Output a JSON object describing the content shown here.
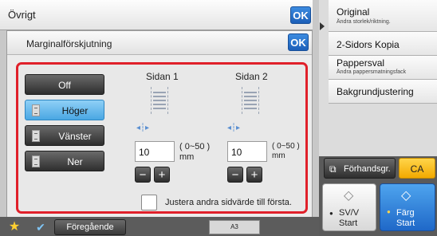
{
  "top_panel": {
    "title": "Övrigt",
    "ok_label": "OK"
  },
  "dialog": {
    "title": "Marginalförskjutning",
    "ok_label": "OK",
    "directions": [
      {
        "label": "Off",
        "selected": false
      },
      {
        "label": "Höger",
        "selected": true
      },
      {
        "label": "Vänster",
        "selected": false
      },
      {
        "label": "Ner",
        "selected": false
      }
    ],
    "side1": {
      "heading": "Sidan 1",
      "value": "10",
      "range": "( 0~50 )",
      "unit": "mm"
    },
    "side2": {
      "heading": "Sidan 2",
      "value": "10",
      "range": "( 0~50 )",
      "unit": "mm"
    },
    "stepper": {
      "minus": "−",
      "plus": "+"
    },
    "checkbox_label": "Justera andra sidvärde till första."
  },
  "right_menu": {
    "items": [
      {
        "title": "Original",
        "subtitle": "Ändra storlek/riktning."
      },
      {
        "title": "2-Sidors Kopia",
        "subtitle": ""
      },
      {
        "title": "Pappersval",
        "subtitle": "Ändra pappersmatningsfack"
      },
      {
        "title": "Bakgrundjustering",
        "subtitle": ""
      }
    ],
    "preview_label": "Förhandsgr.",
    "ca_label": "CA",
    "start_bw": {
      "line1": "SV/V",
      "line2": "Start"
    },
    "start_color": {
      "line1": "Färg",
      "line2": "Start"
    }
  },
  "bottom_bar": {
    "previous_label": "Föregående",
    "tray_label": "A3"
  },
  "colors": {
    "ok_blue": "#1c5fb8",
    "highlight_red": "#e0202a",
    "selected_blue": "#4aa7e3",
    "ca_yellow": "#f2a900"
  }
}
